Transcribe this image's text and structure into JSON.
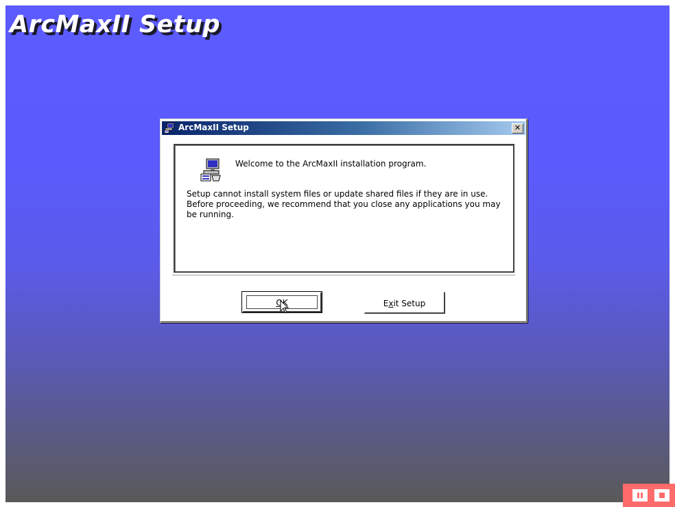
{
  "screen": {
    "banner_title": "ArcMaxII Setup"
  },
  "dialog": {
    "title": "ArcMaxII Setup",
    "close_label": "✕",
    "welcome": "Welcome to the ArcMaxII installation program.",
    "body": "Setup cannot install system files or update shared files if they are in use. Before proceeding, we recommend that you close any applications you may be running.",
    "ok_button": {
      "prefix": "",
      "accel": "O",
      "suffix": "K"
    },
    "exit_button": {
      "prefix": "E",
      "accel": "x",
      "suffix": "it Setup"
    }
  },
  "icons": {
    "title_icon": "setup-computer-icon",
    "content_icon": "setup-computer-icon",
    "pause": "pause-icon",
    "stop": "stop-icon"
  },
  "colors": {
    "background_top": "#5b5bfe",
    "background_bottom": "#595959",
    "titlebar_start": "#0a246a",
    "tray_accent": "#ff6b6b"
  }
}
